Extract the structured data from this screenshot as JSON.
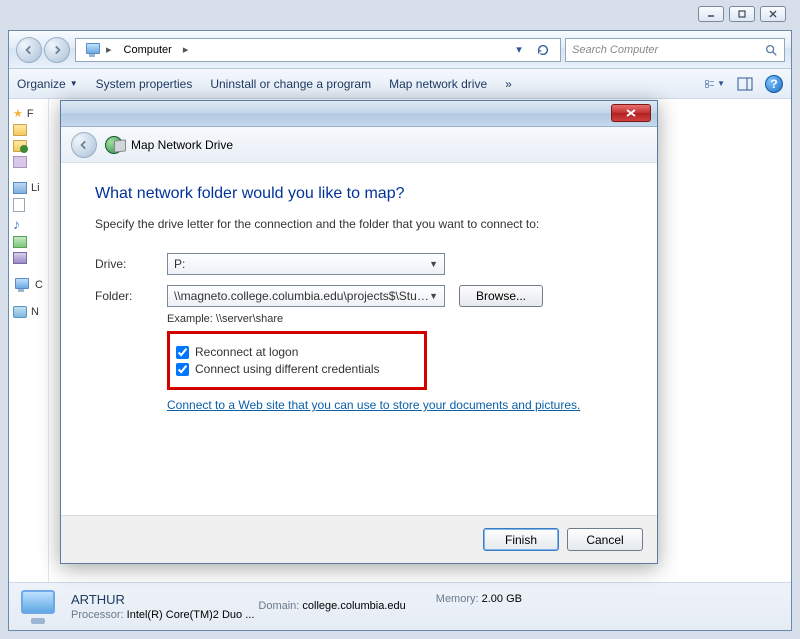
{
  "window_controls": {
    "min": "minimize",
    "max": "maximize",
    "close": "close"
  },
  "address": {
    "root_icon": "computer-icon",
    "crumb": "Computer",
    "dropdown_hint": "▸"
  },
  "search": {
    "placeholder": "Search Computer"
  },
  "toolbar": {
    "organize": "Organize",
    "system_properties": "System properties",
    "uninstall": "Uninstall or change a program",
    "map_drive": "Map network drive",
    "overflow": "»"
  },
  "sidebar": {
    "favorites": "Favorites",
    "libraries": "Libraries",
    "computer": "Computer",
    "network": "Network",
    "fav_label_short": "F",
    "lib_label_short": "Li",
    "comp_label_short": "C",
    "net_label_short": "N"
  },
  "details": {
    "name": "ARTHUR",
    "domain_label": "Domain:",
    "domain_value": "college.columbia.edu",
    "processor_label": "Processor:",
    "processor_value": "Intel(R) Core(TM)2 Duo ...",
    "memory_label": "Memory:",
    "memory_value": "2.00 GB"
  },
  "dialog": {
    "title": "Map Network Drive",
    "heading": "What network folder would you like to map?",
    "description": "Specify the drive letter for the connection and the folder that you want to connect to:",
    "drive_label": "Drive:",
    "drive_value": "P:",
    "folder_label": "Folder:",
    "folder_value": "\\\\magneto.college.columbia.edu\\projects$\\Studer",
    "browse": "Browse...",
    "example": "Example: \\\\server\\share",
    "reconnect": "Reconnect at logon",
    "diff_creds": "Connect using different credentials",
    "link": "Connect to a Web site that you can use to store your documents and pictures.",
    "finish": "Finish",
    "cancel": "Cancel"
  }
}
